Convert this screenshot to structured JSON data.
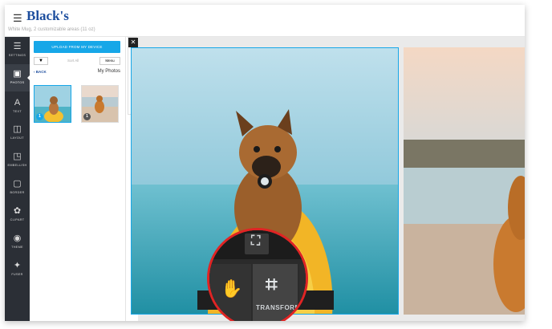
{
  "header": {
    "brand": "Black's",
    "project_subtitle": "White Mug, 2 customizable areas (11 oz)"
  },
  "rail": {
    "items": [
      {
        "label": "SETTINGS",
        "icon": "sliders-icon"
      },
      {
        "label": "PHOTOS",
        "icon": "image-icon",
        "active": true
      },
      {
        "label": "TEXT",
        "icon": "text-icon"
      },
      {
        "label": "LAYOUT",
        "icon": "layout-icon"
      },
      {
        "label": "EMBELLISH",
        "icon": "embellish-icon"
      },
      {
        "label": "BORDER",
        "icon": "border-icon"
      },
      {
        "label": "CLIPART",
        "icon": "clipart-icon"
      },
      {
        "label": "THEME",
        "icon": "palette-icon"
      },
      {
        "label": "FUSER",
        "icon": "sparkle-icon"
      }
    ]
  },
  "photos_panel": {
    "upload_label": "UPLOAD FROM MY DEVICE",
    "sort_label": "Sort All",
    "menu_label": "Menu",
    "back_label": "BACK",
    "folder_title": "My Photos",
    "thumbnails": [
      {
        "badge": "1",
        "selected": true,
        "badge_color": "#17a7e8"
      },
      {
        "badge": "1",
        "selected": false,
        "badge_color": "#555555"
      }
    ]
  },
  "tools": {
    "close": "✕",
    "undo": "↶",
    "redo": "↷",
    "cut": "✂",
    "copy": "⧉",
    "paste": "▤"
  },
  "zoom_callout": {
    "transform_label": "TRANSFORM",
    "icons": [
      "hand-icon",
      "transform-icon",
      "crop-icon",
      "trash-icon"
    ],
    "ring_color": "#e02424"
  },
  "colors": {
    "accent": "#17a7e8",
    "brand": "#1d4e9e",
    "rail": "#2b2f36"
  }
}
